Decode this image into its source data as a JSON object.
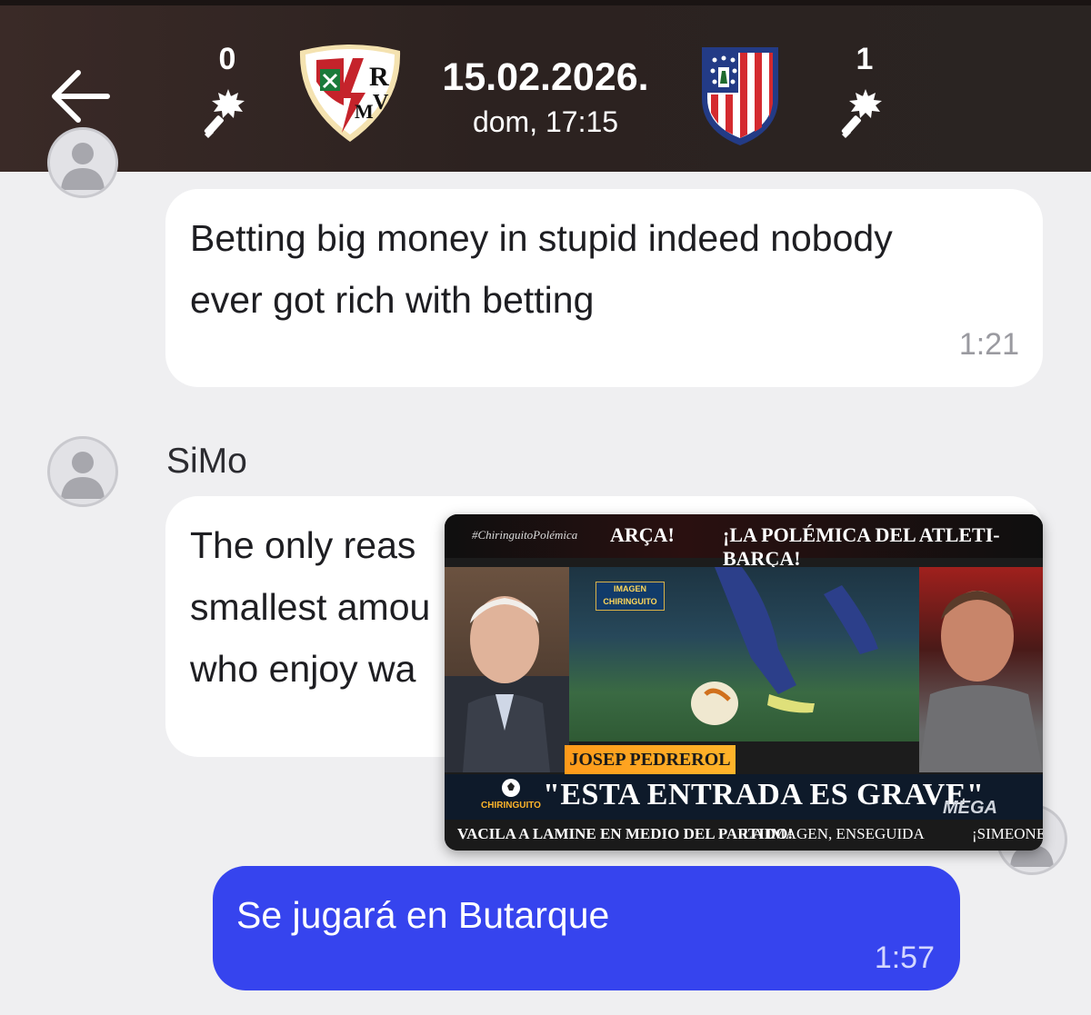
{
  "header": {
    "home_score": "0",
    "away_score": "1",
    "date": "15.02.2026.",
    "time": "dom, 17:15",
    "icons": {
      "back": "arrow-left-icon",
      "home_scorers": "goal-ball-icon",
      "away_scorers": "goal-ball-icon",
      "home_crest": "rayo-vallecano-crest",
      "away_crest": "atletico-madrid-crest"
    },
    "colors": {
      "background": "#2c2220",
      "text": "#ffffff"
    }
  },
  "messages": [
    {
      "lines": [
        "Betting big money in stupid indeed nobody",
        "ever got rich with betting"
      ],
      "time": "1:21"
    },
    {
      "sender": "SiMo",
      "lines": [
        "The only reas",
        "smallest amou",
        "who enjoy wa"
      ]
    },
    {
      "text": "Se jugará en Butarque",
      "time": "1:57",
      "outgoing": true
    }
  ],
  "video": {
    "tag": "#ChiringuitoPolémica",
    "ticker_top_left": "ARÇA!",
    "ticker_top_right": "¡LA POLÉMICA DEL ATLETI-BARÇA!",
    "inset_label": "IMAGEN CHIRINGUITO",
    "name_strip": "JOSEP PEDREROL",
    "logo_text": "CHIRINGUITO",
    "headline": "\"ESTA ENTRADA ES GRAVE\"",
    "channel": "MEGA",
    "ticker_bottom_left": "VACILA A LAMINE EN MEDIO DEL PARTIDO!",
    "ticker_bottom_mid": "LA IMAGEN, ENSEGUIDA",
    "ticker_bottom_right": "¡SIMEONE"
  },
  "colors": {
    "chat_background": "#efeff1",
    "incoming_bubble": "#ffffff",
    "outgoing_bubble": "#3644ee"
  }
}
